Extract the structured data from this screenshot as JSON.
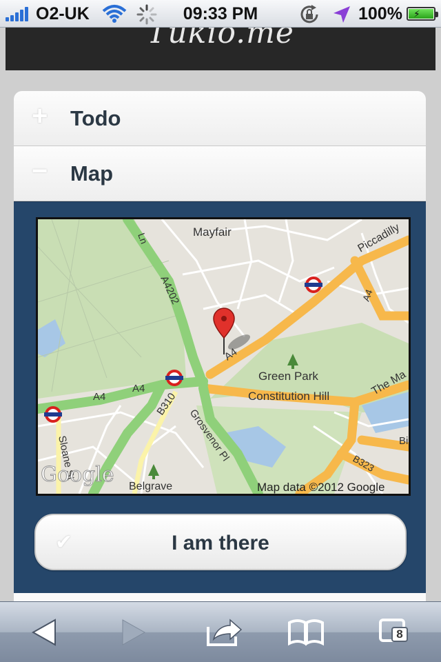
{
  "status_bar": {
    "carrier": "O2-UK",
    "time": "09:33 PM",
    "battery": "100%",
    "icons": [
      "signal-icon",
      "wifi-icon",
      "activity-spinner-icon",
      "rotation-lock-icon",
      "location-arrow-icon",
      "battery-charging-icon"
    ]
  },
  "header": {
    "brand": "Tukio.me"
  },
  "accordion": {
    "items": [
      {
        "sign": "+",
        "label": "Todo"
      },
      {
        "sign": "−",
        "label": "Map"
      }
    ]
  },
  "map": {
    "labels": {
      "mayfair": "Mayfair",
      "piccadilly": "Piccadilly",
      "a4202": "A4202",
      "a4_road": "A4",
      "a4_right": "A4",
      "green_park": "Green Park",
      "a4_left1": "A4",
      "a4_left2": "A4",
      "constitution_hill": "Constitution Hill",
      "the_mall": "The Ma",
      "b310": "B310",
      "grosvenor": "Grosvenor Pl",
      "sloane": "Sloane St",
      "belgrave": "Belgrave",
      "b323": "B323",
      "bi": "Bi",
      "ln": "Ln",
      "google_logo": "Google",
      "attribution": "Map data ©2012 Google"
    }
  },
  "action_button": {
    "label": "I am there",
    "icon": "checkmark-icon"
  },
  "toolbar": {
    "tabs_count": "8",
    "icons": [
      "back-icon",
      "forward-icon",
      "share-icon",
      "bookmarks-icon",
      "tabs-icon"
    ]
  },
  "colors": {
    "accent_panel": "#25466a",
    "header_bg": "#272727",
    "text_dark": "#2b3844"
  }
}
